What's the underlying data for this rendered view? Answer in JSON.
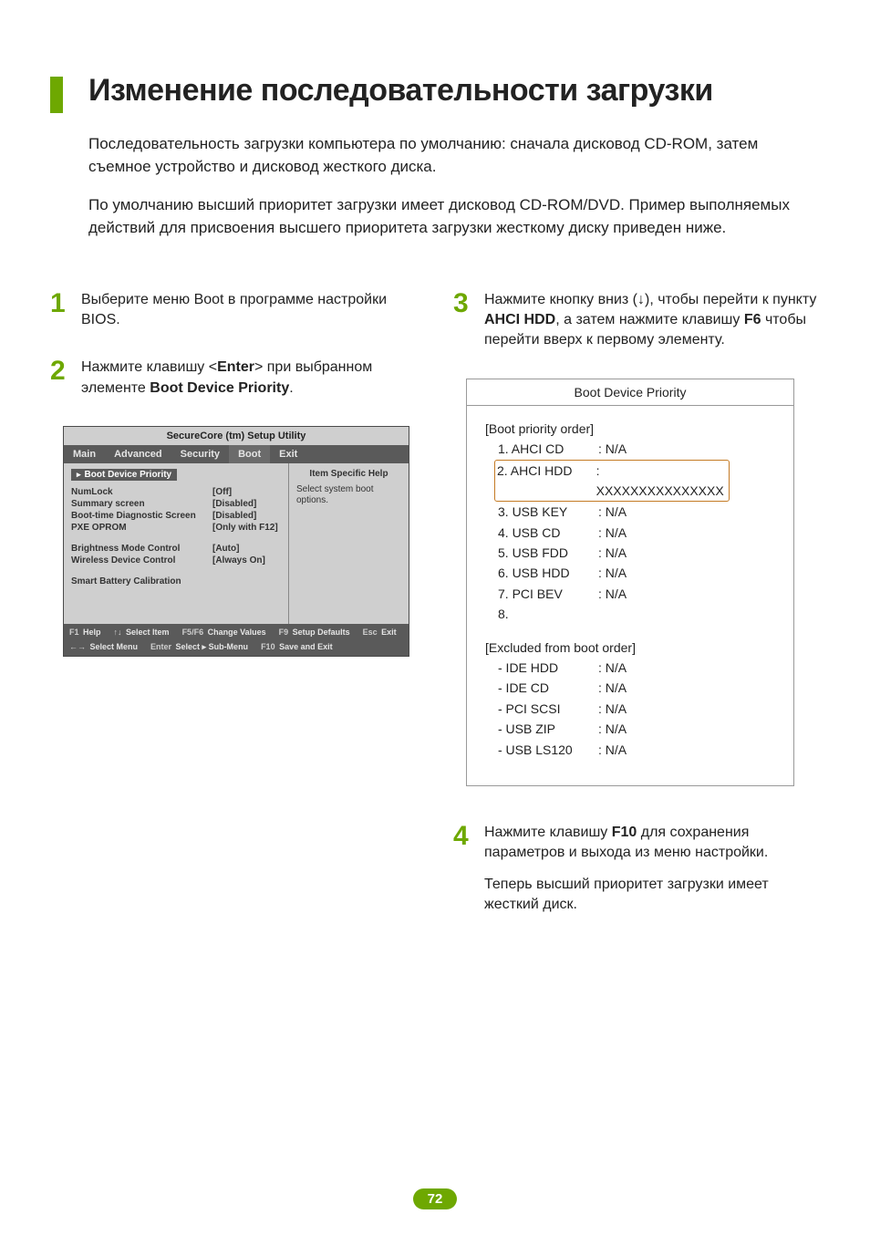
{
  "page": {
    "title": "Изменение последовательности загрузки",
    "intro1": "Последовательность загрузки компьютера по умолчанию: сначала дисковод CD-ROM, затем съемное устройство и дисковод жесткого диска.",
    "intro2": "По умолчанию высший приоритет загрузки имеет дисковод CD-ROM/DVD. Пример выполняемых действий для присвоения высшего приоритета загрузки жесткому диску приведен ниже.",
    "page_number": "72"
  },
  "steps": {
    "s1": {
      "num": "1",
      "text_a": "Выберите меню Boot в программе настройки BIOS."
    },
    "s2": {
      "num": "2",
      "text_a": "Нажмите клавишу <",
      "key": "Enter",
      "text_b": "> при выбранном элементе ",
      "bold": "Boot Device Priority",
      "text_c": "."
    },
    "s3": {
      "num": "3",
      "text_a": "Нажмите кнопку вниз (↓), чтобы перейти к пункту ",
      "bold1": "AHCI HDD",
      "text_b": ", а затем нажмите клавишу ",
      "bold2": "F6",
      "text_c": " чтобы перейти вверх к первому элементу."
    },
    "s4": {
      "num": "4",
      "text_a": "Нажмите клавишу ",
      "bold": "F10",
      "text_b": " для сохранения параметров и выхода из меню настройки.",
      "text_c": "Теперь высший приоритет загрузки имеет жесткий диск."
    }
  },
  "bios": {
    "title": "SecureCore (tm) Setup Utility",
    "menu": [
      "Main",
      "Advanced",
      "Security",
      "Boot",
      "Exit"
    ],
    "highlight": "Boot Device Priority",
    "rows": [
      {
        "l": "NumLock",
        "v": "[Off]"
      },
      {
        "l": "Summary screen",
        "v": "[Disabled]"
      },
      {
        "l": "Boot-time Diagnostic Screen",
        "v": "[Disabled]"
      },
      {
        "l": "PXE OPROM",
        "v": "[Only with F12]"
      }
    ],
    "rows2": [
      {
        "l": "Brightness Mode Control",
        "v": "[Auto]"
      },
      {
        "l": "Wireless Device Control",
        "v": "[Always On]"
      }
    ],
    "rows3": [
      {
        "l": "Smart Battery Calibration",
        "v": ""
      }
    ],
    "help_title": "Item Specific Help",
    "help_text": "Select system boot options.",
    "footer": [
      {
        "k": "F1",
        "t": "Help"
      },
      {
        "k": "↑↓",
        "t": "Select Item"
      },
      {
        "k": "F5/F6",
        "t": "Change Values"
      },
      {
        "k": "F9",
        "t": "Setup Defaults"
      },
      {
        "k": "Esc",
        "t": "Exit"
      },
      {
        "k": "←→",
        "t": "Select Menu"
      },
      {
        "k": "Enter",
        "t": "Select ▸ Sub-Menu"
      },
      {
        "k": "F10",
        "t": "Save and Exit"
      }
    ]
  },
  "panel": {
    "title": "Boot Device Priority",
    "section1_label": "[Boot priority order]",
    "priority": [
      {
        "l": "1. AHCI CD",
        "v": ": N/A"
      },
      {
        "l": "2. AHCI HDD",
        "v": ": XXXXXXXXXXXXXXX",
        "selected": true
      },
      {
        "l": "3. USB KEY",
        "v": ": N/A"
      },
      {
        "l": "4. USB CD",
        "v": ": N/A"
      },
      {
        "l": "5. USB FDD",
        "v": ": N/A"
      },
      {
        "l": "6. USB HDD",
        "v": ": N/A"
      },
      {
        "l": "7. PCI BEV",
        "v": ": N/A"
      },
      {
        "l": "8.",
        "v": ""
      }
    ],
    "section2_label": "[Excluded from boot order]",
    "excluded": [
      {
        "l": "- IDE HDD",
        "v": ": N/A"
      },
      {
        "l": "- IDE CD",
        "v": ": N/A"
      },
      {
        "l": "- PCI SCSI",
        "v": ": N/A"
      },
      {
        "l": "- USB ZIP",
        "v": ": N/A"
      },
      {
        "l": "- USB LS120",
        "v": ": N/A"
      }
    ]
  }
}
